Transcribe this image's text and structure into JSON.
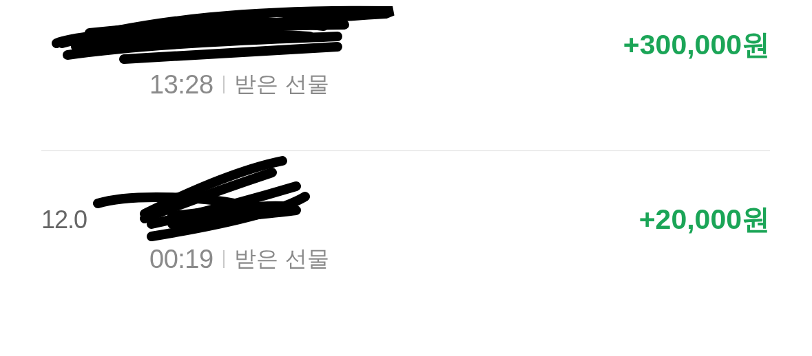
{
  "transactions": [
    {
      "time": "13:28",
      "type": "받은 선물",
      "amount": "+300,000원"
    },
    {
      "date": "12.0",
      "time": "00:19",
      "type": "받은 선물",
      "amount": "+20,000원"
    }
  ]
}
